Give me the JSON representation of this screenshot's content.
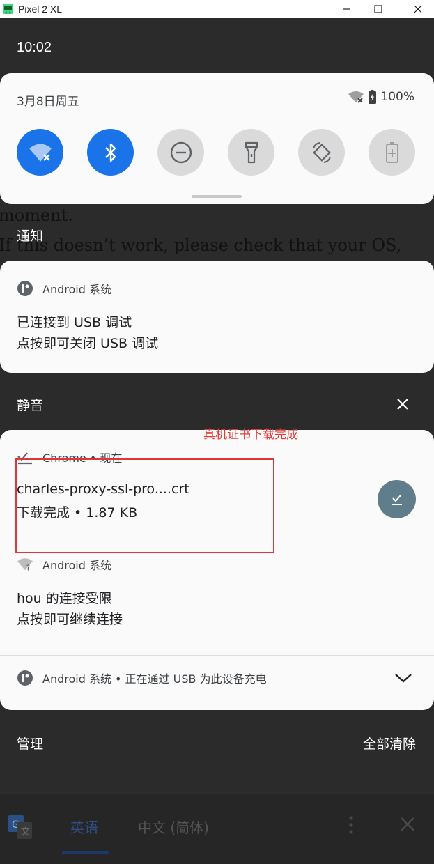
{
  "window": {
    "title": "Pixel 2 XL",
    "controls": [
      "minimize",
      "maximize",
      "close"
    ]
  },
  "status_bar": {
    "time": "10:02"
  },
  "background_page": {
    "lines": [
      "moment.",
      "If this doesn’t work, please check that your OS,",
      "                                                     "
    ]
  },
  "quick_settings": {
    "date": "3月8日周五",
    "battery": "100%",
    "tiles": [
      {
        "name": "wifi",
        "on": true
      },
      {
        "name": "bluetooth",
        "on": true
      },
      {
        "name": "do-not-disturb",
        "on": false
      },
      {
        "name": "flashlight",
        "on": false
      },
      {
        "name": "auto-rotate",
        "on": false
      },
      {
        "name": "battery-saver",
        "on": false
      }
    ]
  },
  "sections": {
    "notifications_label": "通知",
    "silent_label": "静音"
  },
  "notifications": {
    "usb_debug": {
      "app": "Android 系统",
      "title": "已连接到 USB 调试",
      "text": "点按即可关闭 USB 调试"
    },
    "download": {
      "app": "Chrome • 现在",
      "title": "charles-proxy-ssl-pro....crt",
      "text": "下载完成 • 1.87 KB"
    },
    "wifi_limited": {
      "app": "Android 系统",
      "title": "hou 的连接受限",
      "text": "点按即可继续连接"
    },
    "charging": {
      "app": "Android 系统 • 正在通过 USB 为此设备充电"
    }
  },
  "annotation": {
    "text": "真机证书下载完成"
  },
  "footer": {
    "manage": "管理",
    "clear_all": "全部清除"
  },
  "translate_bar": {
    "lang_selected": "英语",
    "lang_other": "中文 (简体)"
  },
  "colors": {
    "accent": "#1a73e8",
    "download_button": "#607d8b",
    "annotation": "#e53935"
  }
}
